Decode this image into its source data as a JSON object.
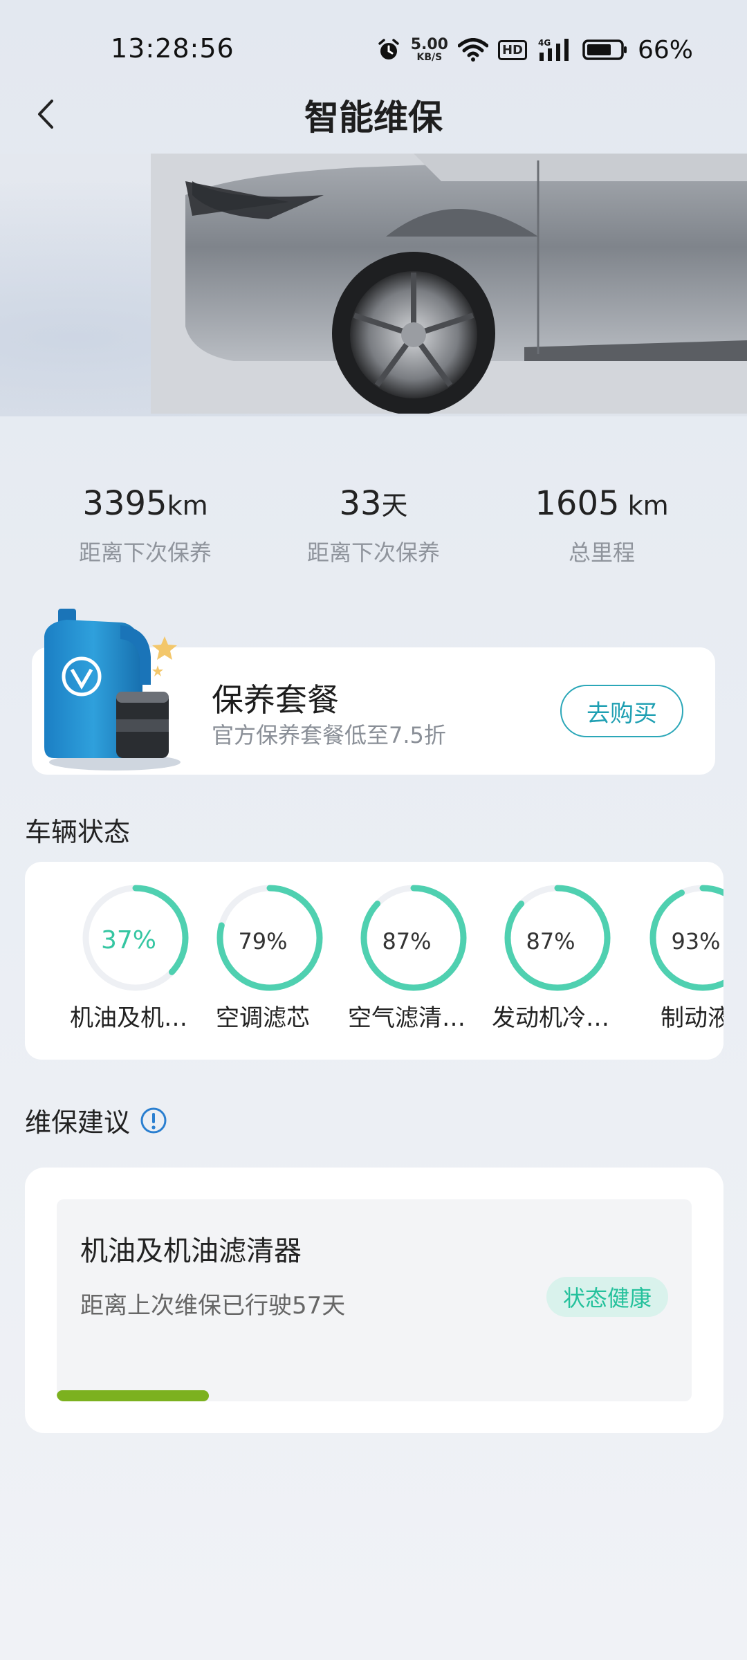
{
  "status_bar": {
    "time": "13:28:56",
    "net_speed_value": "5.00",
    "net_speed_unit": "KB/S",
    "hd_label": "HD",
    "network_type": "4G",
    "battery_percent": "66%"
  },
  "nav": {
    "title": "智能维保"
  },
  "stats": [
    {
      "value": "3395",
      "unit": "km",
      "label": "距离下次保养"
    },
    {
      "value": "33",
      "unit": "天",
      "label": "距离下次保养"
    },
    {
      "value": "1605",
      "unit": " km",
      "label": "总里程"
    }
  ],
  "package": {
    "title": "保养套餐",
    "subtitle": "官方保养套餐低至7.5折",
    "button": "去购买"
  },
  "vehicle_status": {
    "title": "车辆状态",
    "items": [
      {
        "percent": 37,
        "percent_text": "37%",
        "label": "机油及机…"
      },
      {
        "percent": 79,
        "percent_text": "79%",
        "label": "空调滤芯"
      },
      {
        "percent": 87,
        "percent_text": "87%",
        "label": "空气滤清…"
      },
      {
        "percent": 87,
        "percent_text": "87%",
        "label": "发动机冷…"
      },
      {
        "percent": 93,
        "percent_text": "93%",
        "label": "制动液"
      }
    ]
  },
  "advice": {
    "title": "维保建议",
    "item": {
      "name": "机油及机油滤清器",
      "desc": "距离上次维保已行驶57天",
      "badge": "状态健康",
      "progress": 0.24
    }
  },
  "colors": {
    "accent_teal": "#2ba7b8",
    "gauge_green": "#4fd0b0",
    "gauge_track": "#eef0f4",
    "healthy_text": "#25c19c",
    "progress_green": "#7cb11f"
  }
}
